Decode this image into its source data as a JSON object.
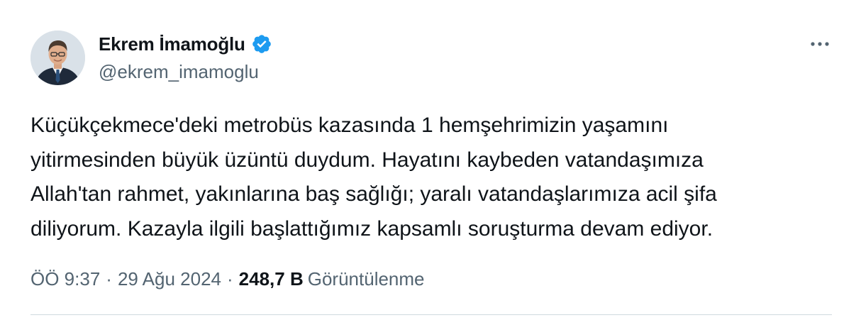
{
  "author": {
    "display_name": "Ekrem İmamoğlu",
    "handle": "@ekrem_imamoglu",
    "verified": true,
    "verified_color": "#1d9bf0"
  },
  "tweet": {
    "text_lines": [
      "Küçükçekmece'deki metrobüs kazasında 1 hemşehrimizin yaşamını",
      "yitirmesinden büyük üzüntü duydum. Hayatını kaybeden vatandaşımıza",
      "Allah'tan rahmet, yakınlarına baş sağlığı; yaralı vatandaşlarımıza acil şifa",
      "diliyorum. Kazayla ilgili başlattığımız kapsamlı soruşturma devam ediyor."
    ]
  },
  "meta": {
    "time": "ÖÖ 9:37",
    "separator": "·",
    "date": "29 Ağu 2024",
    "views_count": "248,7 B",
    "views_label": "Görüntülenme"
  },
  "icons": {
    "more": "more-horizontal-icon",
    "verified": "verified-badge-icon"
  },
  "colors": {
    "text_primary": "#0f1419",
    "text_secondary": "#536471",
    "divider": "#cfd9de"
  }
}
